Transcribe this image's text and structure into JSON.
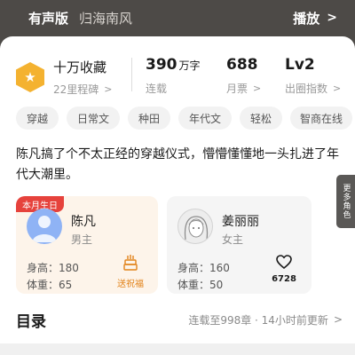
{
  "audio_bar": {
    "tag": "有声版",
    "name": "归海南风",
    "play_label": "播放",
    "play_chevron": ">"
  },
  "stats": {
    "collect_title": "十万收藏",
    "collect_sub": "22里程碑",
    "collect_icon": "star-icon",
    "words_value": "390",
    "words_unit": "万字",
    "words_label": "连载",
    "votes_value": "688",
    "votes_label": "月票",
    "level_value": "Lv2",
    "level_label": "出圈指数",
    "chevron": ">"
  },
  "tags": [
    "穿越",
    "日常文",
    "种田",
    "年代文",
    "轻松",
    "智商在线"
  ],
  "synopsis": "陈凡搞了个不太正经的穿越仪式，懵懵懂懂地一头扎进了年代大潮里。",
  "characters": [
    {
      "badge": "本月生日",
      "name": "陈凡",
      "role": "男主",
      "height": "身高：180",
      "weight": "体重：65",
      "action_label": "送祝福",
      "action_icon": "cake-icon"
    },
    {
      "name": "姜丽丽",
      "role": "女主",
      "height": "身高：160",
      "weight": "体重：50",
      "action_label": "6728",
      "action_icon": "heart-icon"
    }
  ],
  "more_roles": "更多角色",
  "catalog": {
    "title": "目录",
    "info": "连载至998章 · 14小时前更新",
    "chevron": ">"
  },
  "colors": {
    "badge_red": "#e6423c",
    "star_gold": "#f4b230",
    "blessing_orange": "#e2831b"
  }
}
